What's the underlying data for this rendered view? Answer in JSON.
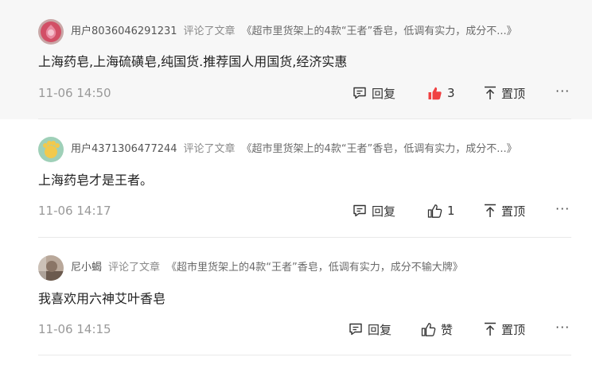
{
  "comments": [
    {
      "user": "用户8036046291231",
      "action": "评论了文章",
      "article": "《超市里货架上的4款“王者”香皂，低调有实力，成分不...》",
      "text": "上海药皂,上海硫磺皂,纯国货.推荐国人用国货,经济实惠",
      "time": "11-06 14:50",
      "reply_label": "回复",
      "like_count": "3",
      "liked": true,
      "pin_label": "置顶",
      "more": "···"
    },
    {
      "user": "用户4371306477244",
      "action": "评论了文章",
      "article": "《超市里货架上的4款“王者”香皂，低调有实力，成分不...》",
      "text": "上海药皂才是王者。",
      "time": "11-06 14:17",
      "reply_label": "回复",
      "like_count": "1",
      "liked": false,
      "pin_label": "置顶",
      "more": "···"
    },
    {
      "user": "尼小蝎",
      "action": "评论了文章",
      "article": "《超市里货架上的4款“王者”香皂，低调有实力，成分不输大牌》",
      "text": "我喜欢用六神艾叶香皂",
      "time": "11-06 14:15",
      "reply_label": "回复",
      "like_count": "赞",
      "liked": false,
      "pin_label": "置顶",
      "more": "···"
    }
  ],
  "colors": {
    "like_active": "#f04142",
    "highlight_bg": "#f7f7f7"
  }
}
